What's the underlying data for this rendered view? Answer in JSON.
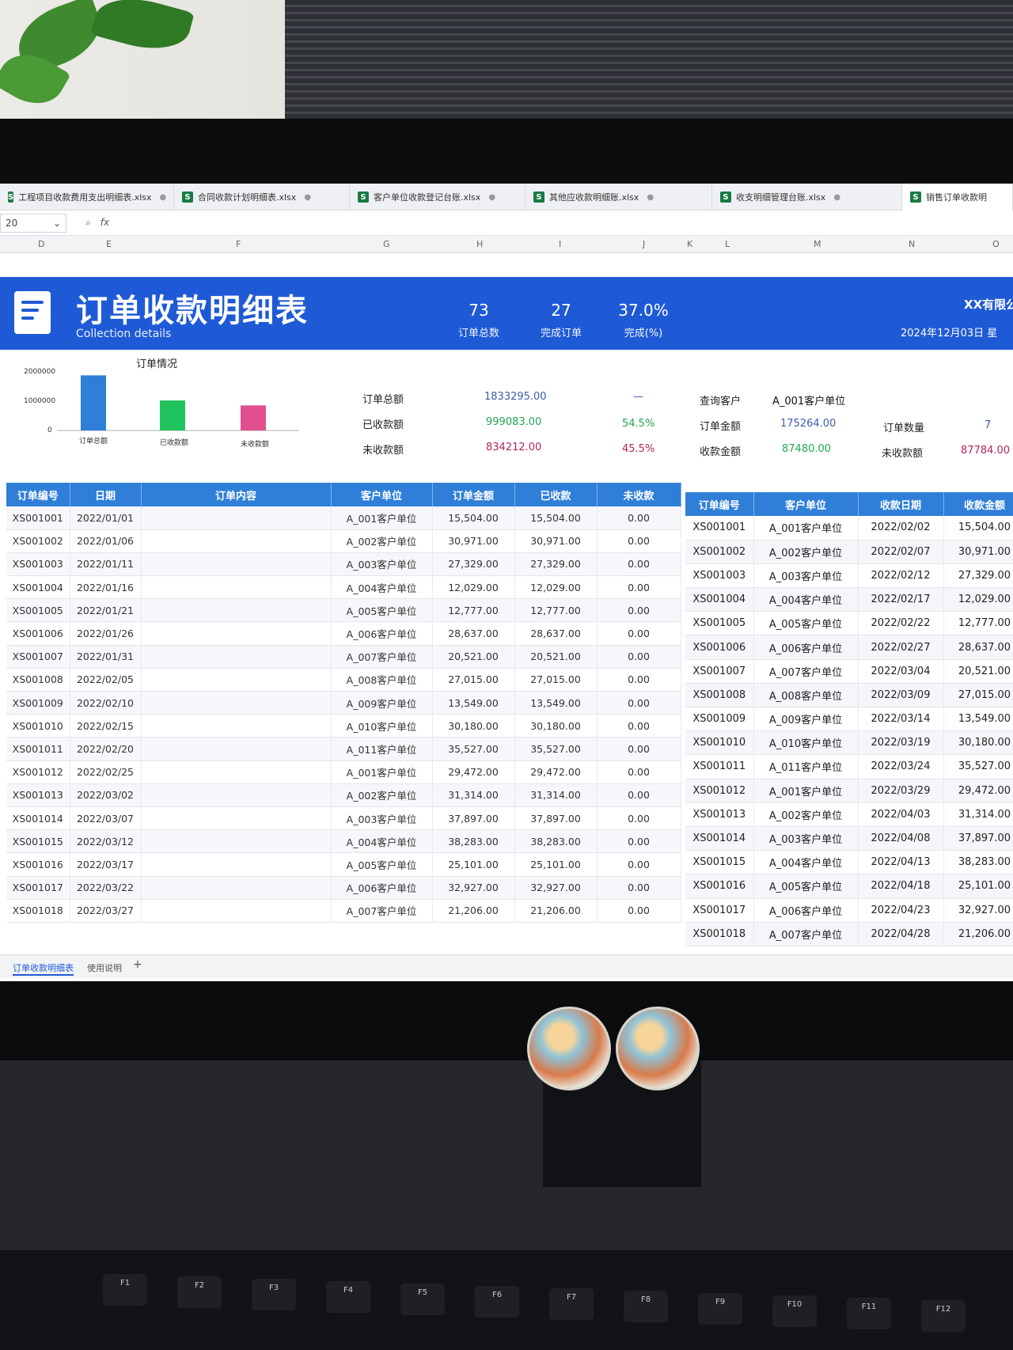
{
  "file_tabs": [
    "工程项目收款费用支出明细表.xlsx",
    "合同收款计划明细表.xlsx",
    "客户单位收款登记台账.xlsx",
    "其他应收款明细账.xlsx",
    "收支明细管理台账.xlsx",
    "销售订单收款明"
  ],
  "formula": {
    "namebox": "20",
    "fx": "fx"
  },
  "columns": [
    "D",
    "E",
    "F",
    "G",
    "H",
    "I",
    "J",
    "K",
    "L",
    "M",
    "N",
    "O"
  ],
  "banner": {
    "title": "订单收款明细表",
    "subtitle": "Collection details",
    "kpis": [
      {
        "value": "73",
        "label": "订单总数"
      },
      {
        "value": "27",
        "label": "完成订单"
      },
      {
        "value": "37.0%",
        "label": "完成(%)"
      }
    ],
    "company": "XX有限公",
    "date": "2024年12月03日 星"
  },
  "chart_data": {
    "type": "bar",
    "title": "订单情况",
    "categories": [
      "订单总额",
      "已收款额",
      "未收款额"
    ],
    "values": [
      1833295,
      999083,
      834212
    ],
    "ylim": [
      0,
      2000000
    ],
    "yticks": [
      "2000000",
      "1000000",
      "0"
    ],
    "colors": [
      "#2f7fd8",
      "#21c45c",
      "#e14f8f"
    ]
  },
  "summary": {
    "total_label": "订单总额",
    "total": "1833295.00",
    "total_pct": "—",
    "received_label": "已收款额",
    "received": "999083.00",
    "received_pct": "54.5%",
    "unreceived_label": "未收款额",
    "unreceived": "834212.00",
    "unreceived_pct": "45.5%",
    "query_label": "查询客户",
    "query_value": "A_001客户单位",
    "order_amount_label": "订单金额",
    "order_amount": "175264.00",
    "order_count_label": "订单数量",
    "order_count": "7",
    "collect_amount_label": "收款金额",
    "collect_amount": "87480.00",
    "uncollected_label": "未收款额",
    "uncollected": "87784.00"
  },
  "left_table": {
    "headers": [
      "订单编号",
      "日期",
      "订单内容",
      "客户单位",
      "订单金额",
      "已收款",
      "未收款"
    ],
    "rows": [
      [
        "XS001001",
        "2022/01/01",
        "",
        "A_001客户单位",
        "15,504.00",
        "15,504.00",
        "0.00"
      ],
      [
        "XS001002",
        "2022/01/06",
        "",
        "A_002客户单位",
        "30,971.00",
        "30,971.00",
        "0.00"
      ],
      [
        "XS001003",
        "2022/01/11",
        "",
        "A_003客户单位",
        "27,329.00",
        "27,329.00",
        "0.00"
      ],
      [
        "XS001004",
        "2022/01/16",
        "",
        "A_004客户单位",
        "12,029.00",
        "12,029.00",
        "0.00"
      ],
      [
        "XS001005",
        "2022/01/21",
        "",
        "A_005客户单位",
        "12,777.00",
        "12,777.00",
        "0.00"
      ],
      [
        "XS001006",
        "2022/01/26",
        "",
        "A_006客户单位",
        "28,637.00",
        "28,637.00",
        "0.00"
      ],
      [
        "XS001007",
        "2022/01/31",
        "",
        "A_007客户单位",
        "20,521.00",
        "20,521.00",
        "0.00"
      ],
      [
        "XS001008",
        "2022/02/05",
        "",
        "A_008客户单位",
        "27,015.00",
        "27,015.00",
        "0.00"
      ],
      [
        "XS001009",
        "2022/02/10",
        "",
        "A_009客户单位",
        "13,549.00",
        "13,549.00",
        "0.00"
      ],
      [
        "XS001010",
        "2022/02/15",
        "",
        "A_010客户单位",
        "30,180.00",
        "30,180.00",
        "0.00"
      ],
      [
        "XS001011",
        "2022/02/20",
        "",
        "A_011客户单位",
        "35,527.00",
        "35,527.00",
        "0.00"
      ],
      [
        "XS001012",
        "2022/02/25",
        "",
        "A_001客户单位",
        "29,472.00",
        "29,472.00",
        "0.00"
      ],
      [
        "XS001013",
        "2022/03/02",
        "",
        "A_002客户单位",
        "31,314.00",
        "31,314.00",
        "0.00"
      ],
      [
        "XS001014",
        "2022/03/07",
        "",
        "A_003客户单位",
        "37,897.00",
        "37,897.00",
        "0.00"
      ],
      [
        "XS001015",
        "2022/03/12",
        "",
        "A_004客户单位",
        "38,283.00",
        "38,283.00",
        "0.00"
      ],
      [
        "XS001016",
        "2022/03/17",
        "",
        "A_005客户单位",
        "25,101.00",
        "25,101.00",
        "0.00"
      ],
      [
        "XS001017",
        "2022/03/22",
        "",
        "A_006客户单位",
        "32,927.00",
        "32,927.00",
        "0.00"
      ],
      [
        "XS001018",
        "2022/03/27",
        "",
        "A_007客户单位",
        "21,206.00",
        "21,206.00",
        "0.00"
      ]
    ]
  },
  "right_table": {
    "headers": [
      "订单编号",
      "客户单位",
      "收款日期",
      "收款金额"
    ],
    "rows": [
      [
        "XS001001",
        "A_001客户单位",
        "2022/02/02",
        "15,504.00"
      ],
      [
        "XS001002",
        "A_002客户单位",
        "2022/02/07",
        "30,971.00"
      ],
      [
        "XS001003",
        "A_003客户单位",
        "2022/02/12",
        "27,329.00"
      ],
      [
        "XS001004",
        "A_004客户单位",
        "2022/02/17",
        "12,029.00"
      ],
      [
        "XS001005",
        "A_005客户单位",
        "2022/02/22",
        "12,777.00"
      ],
      [
        "XS001006",
        "A_006客户单位",
        "2022/02/27",
        "28,637.00"
      ],
      [
        "XS001007",
        "A_007客户单位",
        "2022/03/04",
        "20,521.00"
      ],
      [
        "XS001008",
        "A_008客户单位",
        "2022/03/09",
        "27,015.00"
      ],
      [
        "XS001009",
        "A_009客户单位",
        "2022/03/14",
        "13,549.00"
      ],
      [
        "XS001010",
        "A_010客户单位",
        "2022/03/19",
        "30,180.00"
      ],
      [
        "XS001011",
        "A_011客户单位",
        "2022/03/24",
        "35,527.00"
      ],
      [
        "XS001012",
        "A_001客户单位",
        "2022/03/29",
        "29,472.00"
      ],
      [
        "XS001013",
        "A_002客户单位",
        "2022/04/03",
        "31,314.00"
      ],
      [
        "XS001014",
        "A_003客户单位",
        "2022/04/08",
        "37,897.00"
      ],
      [
        "XS001015",
        "A_004客户单位",
        "2022/04/13",
        "38,283.00"
      ],
      [
        "XS001016",
        "A_005客户单位",
        "2022/04/18",
        "25,101.00"
      ],
      [
        "XS001017",
        "A_006客户单位",
        "2022/04/23",
        "32,927.00"
      ],
      [
        "XS001018",
        "A_007客户单位",
        "2022/04/28",
        "21,206.00"
      ]
    ]
  },
  "sheet_tabs": [
    "订单收款明细表",
    "使用说明",
    "+"
  ],
  "keyboard": [
    "F1",
    "F2",
    "F3",
    "F4",
    "F5",
    "F6",
    "F7",
    "F8",
    "F9",
    "F10",
    "F11",
    "F12"
  ]
}
